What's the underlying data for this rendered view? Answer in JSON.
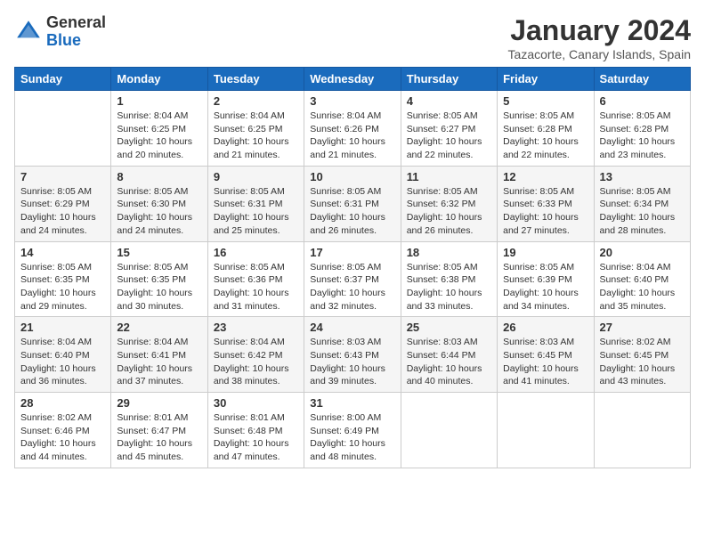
{
  "header": {
    "logo_general": "General",
    "logo_blue": "Blue",
    "month_year": "January 2024",
    "location": "Tazacorte, Canary Islands, Spain"
  },
  "days_of_week": [
    "Sunday",
    "Monday",
    "Tuesday",
    "Wednesday",
    "Thursday",
    "Friday",
    "Saturday"
  ],
  "weeks": [
    [
      {
        "day": "",
        "info": ""
      },
      {
        "day": "1",
        "info": "Sunrise: 8:04 AM\nSunset: 6:25 PM\nDaylight: 10 hours\nand 20 minutes."
      },
      {
        "day": "2",
        "info": "Sunrise: 8:04 AM\nSunset: 6:25 PM\nDaylight: 10 hours\nand 21 minutes."
      },
      {
        "day": "3",
        "info": "Sunrise: 8:04 AM\nSunset: 6:26 PM\nDaylight: 10 hours\nand 21 minutes."
      },
      {
        "day": "4",
        "info": "Sunrise: 8:05 AM\nSunset: 6:27 PM\nDaylight: 10 hours\nand 22 minutes."
      },
      {
        "day": "5",
        "info": "Sunrise: 8:05 AM\nSunset: 6:28 PM\nDaylight: 10 hours\nand 22 minutes."
      },
      {
        "day": "6",
        "info": "Sunrise: 8:05 AM\nSunset: 6:28 PM\nDaylight: 10 hours\nand 23 minutes."
      }
    ],
    [
      {
        "day": "7",
        "info": "Sunrise: 8:05 AM\nSunset: 6:29 PM\nDaylight: 10 hours\nand 24 minutes."
      },
      {
        "day": "8",
        "info": "Sunrise: 8:05 AM\nSunset: 6:30 PM\nDaylight: 10 hours\nand 24 minutes."
      },
      {
        "day": "9",
        "info": "Sunrise: 8:05 AM\nSunset: 6:31 PM\nDaylight: 10 hours\nand 25 minutes."
      },
      {
        "day": "10",
        "info": "Sunrise: 8:05 AM\nSunset: 6:31 PM\nDaylight: 10 hours\nand 26 minutes."
      },
      {
        "day": "11",
        "info": "Sunrise: 8:05 AM\nSunset: 6:32 PM\nDaylight: 10 hours\nand 26 minutes."
      },
      {
        "day": "12",
        "info": "Sunrise: 8:05 AM\nSunset: 6:33 PM\nDaylight: 10 hours\nand 27 minutes."
      },
      {
        "day": "13",
        "info": "Sunrise: 8:05 AM\nSunset: 6:34 PM\nDaylight: 10 hours\nand 28 minutes."
      }
    ],
    [
      {
        "day": "14",
        "info": "Sunrise: 8:05 AM\nSunset: 6:35 PM\nDaylight: 10 hours\nand 29 minutes."
      },
      {
        "day": "15",
        "info": "Sunrise: 8:05 AM\nSunset: 6:35 PM\nDaylight: 10 hours\nand 30 minutes."
      },
      {
        "day": "16",
        "info": "Sunrise: 8:05 AM\nSunset: 6:36 PM\nDaylight: 10 hours\nand 31 minutes."
      },
      {
        "day": "17",
        "info": "Sunrise: 8:05 AM\nSunset: 6:37 PM\nDaylight: 10 hours\nand 32 minutes."
      },
      {
        "day": "18",
        "info": "Sunrise: 8:05 AM\nSunset: 6:38 PM\nDaylight: 10 hours\nand 33 minutes."
      },
      {
        "day": "19",
        "info": "Sunrise: 8:05 AM\nSunset: 6:39 PM\nDaylight: 10 hours\nand 34 minutes."
      },
      {
        "day": "20",
        "info": "Sunrise: 8:04 AM\nSunset: 6:40 PM\nDaylight: 10 hours\nand 35 minutes."
      }
    ],
    [
      {
        "day": "21",
        "info": "Sunrise: 8:04 AM\nSunset: 6:40 PM\nDaylight: 10 hours\nand 36 minutes."
      },
      {
        "day": "22",
        "info": "Sunrise: 8:04 AM\nSunset: 6:41 PM\nDaylight: 10 hours\nand 37 minutes."
      },
      {
        "day": "23",
        "info": "Sunrise: 8:04 AM\nSunset: 6:42 PM\nDaylight: 10 hours\nand 38 minutes."
      },
      {
        "day": "24",
        "info": "Sunrise: 8:03 AM\nSunset: 6:43 PM\nDaylight: 10 hours\nand 39 minutes."
      },
      {
        "day": "25",
        "info": "Sunrise: 8:03 AM\nSunset: 6:44 PM\nDaylight: 10 hours\nand 40 minutes."
      },
      {
        "day": "26",
        "info": "Sunrise: 8:03 AM\nSunset: 6:45 PM\nDaylight: 10 hours\nand 41 minutes."
      },
      {
        "day": "27",
        "info": "Sunrise: 8:02 AM\nSunset: 6:45 PM\nDaylight: 10 hours\nand 43 minutes."
      }
    ],
    [
      {
        "day": "28",
        "info": "Sunrise: 8:02 AM\nSunset: 6:46 PM\nDaylight: 10 hours\nand 44 minutes."
      },
      {
        "day": "29",
        "info": "Sunrise: 8:01 AM\nSunset: 6:47 PM\nDaylight: 10 hours\nand 45 minutes."
      },
      {
        "day": "30",
        "info": "Sunrise: 8:01 AM\nSunset: 6:48 PM\nDaylight: 10 hours\nand 47 minutes."
      },
      {
        "day": "31",
        "info": "Sunrise: 8:00 AM\nSunset: 6:49 PM\nDaylight: 10 hours\nand 48 minutes."
      },
      {
        "day": "",
        "info": ""
      },
      {
        "day": "",
        "info": ""
      },
      {
        "day": "",
        "info": ""
      }
    ]
  ]
}
